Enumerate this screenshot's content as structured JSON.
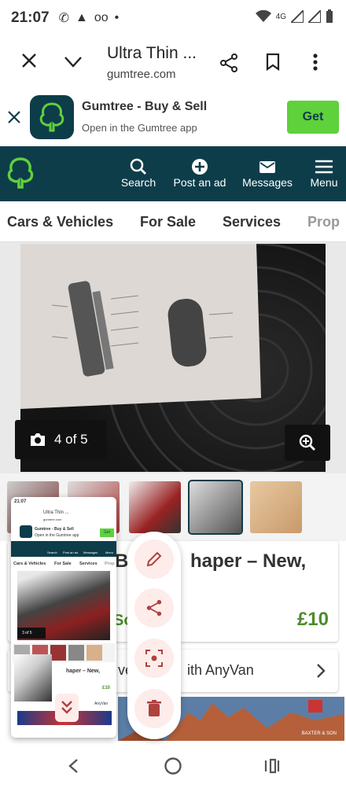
{
  "status_bar": {
    "time": "21:07",
    "network": "4G"
  },
  "browser": {
    "title": "Ultra Thin ...",
    "url": "gumtree.com"
  },
  "app_banner": {
    "name": "Gumtree - Buy & Sell",
    "subtitle": "Open in the Gumtree app",
    "get_label": "Get"
  },
  "gumtree_nav": {
    "items": [
      {
        "label": "Search",
        "icon": "search-icon"
      },
      {
        "label": "Post an ad",
        "icon": "plus-circle-icon"
      },
      {
        "label": "Messages",
        "icon": "envelope-icon"
      },
      {
        "label": "Menu",
        "icon": "hamburger-icon"
      }
    ]
  },
  "categories": [
    "Cars & Vehicles",
    "For Sale",
    "Services",
    "Prop"
  ],
  "gallery": {
    "counter": "4 of 5"
  },
  "listing": {
    "title_visible": "Bo",
    "title_visible_2": "haper – New,",
    "location_visible": "So",
    "price": "£10",
    "delivery_visible": "ve",
    "delivery_visible_2": "ith AnyVan"
  },
  "advert": {
    "text": "BAXTER & SON"
  },
  "preview": {
    "time": "21:07",
    "title": "Ultra Thin ...",
    "url": "gumtree.com",
    "banner_name": "Gumtree - Buy & Sell",
    "banner_sub": "Open in the Gumtree app",
    "get": "Get",
    "nav": [
      "Search",
      "Post an ad",
      "Messages",
      "Menu"
    ],
    "cats": [
      "Cars & Vehicles",
      "For Sale",
      "Services",
      "Prop"
    ],
    "counter": "3 of 5",
    "title_part": "haper – New,",
    "price": "£10",
    "delivery": "AnyVan"
  },
  "colors": {
    "brand_dark": "#0e3d4a",
    "brand_green": "#5fd13b",
    "price_green": "#4a8c2a",
    "fab_bg": "#fdecea",
    "fab_icon": "#b0413e"
  }
}
